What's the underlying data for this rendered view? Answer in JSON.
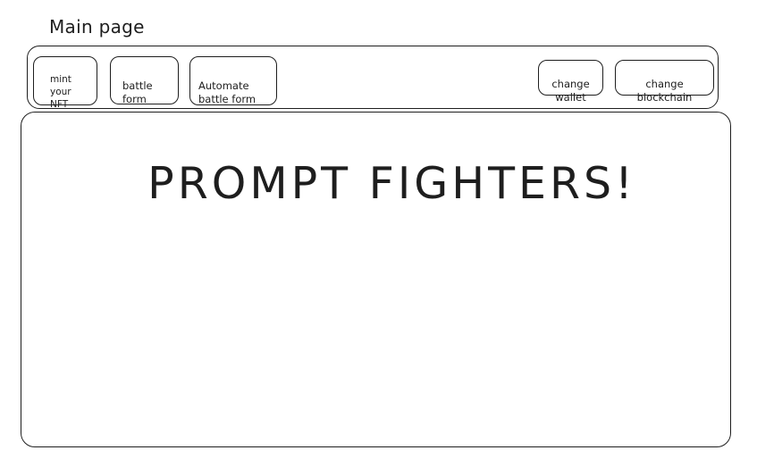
{
  "page": {
    "label": "Main page"
  },
  "navbar": {
    "mint_label": "mint\nyour\nNFT",
    "battle_label": "battle\nform",
    "automate_label": "Automate\nbattle form",
    "wallet_label": "change\nwallet",
    "blockchain_label": "change\nblockchain"
  },
  "main": {
    "title": "PROMPT FIGHTERS!"
  }
}
